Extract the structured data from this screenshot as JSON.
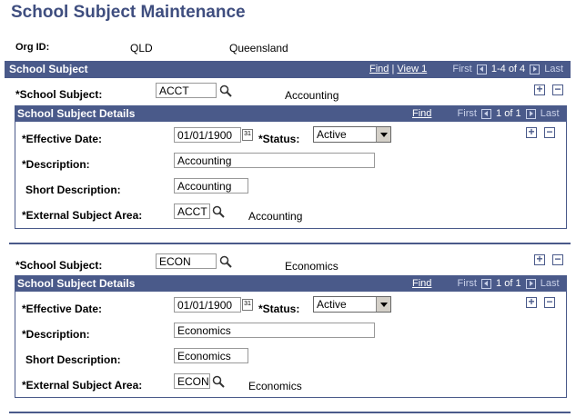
{
  "page": {
    "title": "School Subject Maintenance"
  },
  "org": {
    "label": "Org ID:",
    "id": "QLD",
    "name": "Queensland"
  },
  "grid": {
    "header": "School Subject",
    "find": "Find",
    "view": "View 1",
    "first": "First",
    "range": "1-4 of 4",
    "last": "Last"
  },
  "subgrid": {
    "header": "School Subject Details",
    "find": "Find",
    "first": "First",
    "range": "1 of 1",
    "last": "Last"
  },
  "labels": {
    "school_subject": "*School Subject:",
    "effective_date": "*Effective Date:",
    "status": "*Status:",
    "description": "*Description:",
    "short_description": "Short Description:",
    "external_subject_area": "*External Subject Area:"
  },
  "rows": [
    {
      "school_subject": "ACCT",
      "school_subject_desc": "Accounting",
      "effective_date": "01/01/1900",
      "status": "Active",
      "description": "Accounting",
      "short_description": "Accounting",
      "external_subject_area": "ACCT",
      "external_subject_area_desc": "Accounting"
    },
    {
      "school_subject": "ECON",
      "school_subject_desc": "Economics",
      "effective_date": "01/01/1900",
      "status": "Active",
      "description": "Economics",
      "short_description": "Economics",
      "external_subject_area": "ECON",
      "external_subject_area_desc": "Economics"
    }
  ],
  "icons": {
    "lookup": "magnifier-icon",
    "calendar": "calendar-icon",
    "add": "plus-icon",
    "remove": "minus-icon"
  },
  "colors": {
    "header_bg": "#4a5a8a",
    "title": "#3f4e7f"
  }
}
